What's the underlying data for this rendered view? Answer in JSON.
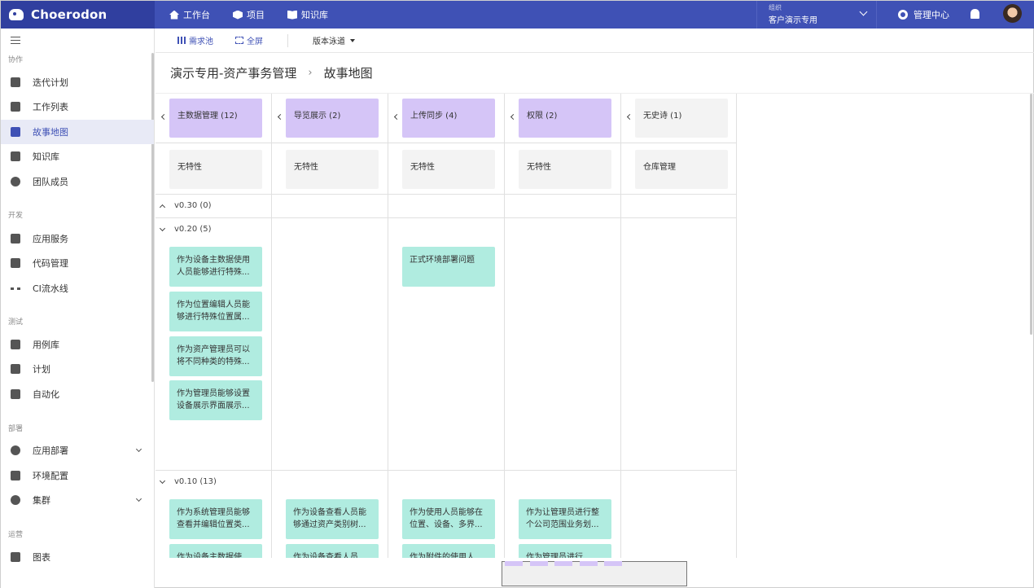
{
  "app": {
    "name": "Choerodon"
  },
  "topnav": [
    {
      "label": "工作台",
      "icon": "home-icon"
    },
    {
      "label": "项目",
      "icon": "cube-icon"
    },
    {
      "label": "知识库",
      "icon": "book-icon"
    }
  ],
  "org": {
    "label": "组织",
    "name": "客户演示专用"
  },
  "mgmt": {
    "label": "管理中心"
  },
  "sidebar": {
    "groups": [
      {
        "title": "协作",
        "items": [
          {
            "label": "迭代计划"
          },
          {
            "label": "工作列表"
          },
          {
            "label": "故事地图",
            "active": true
          },
          {
            "label": "知识库"
          },
          {
            "label": "团队成员"
          }
        ]
      },
      {
        "title": "开发",
        "items": [
          {
            "label": "应用服务"
          },
          {
            "label": "代码管理"
          },
          {
            "label": "CI流水线"
          }
        ]
      },
      {
        "title": "测试",
        "items": [
          {
            "label": "用例库"
          },
          {
            "label": "计划"
          },
          {
            "label": "自动化"
          }
        ]
      },
      {
        "title": "部署",
        "items": [
          {
            "label": "应用部署"
          },
          {
            "label": "环境配置"
          },
          {
            "label": "集群"
          }
        ]
      },
      {
        "title": "运营",
        "items": [
          {
            "label": "图表"
          }
        ]
      }
    ]
  },
  "toolbar": {
    "demand_pool": "需求池",
    "fullscreen": "全屏",
    "swimlane": "版本泳道"
  },
  "breadcrumb": {
    "project": "演示专用-资产事务管理",
    "page": "故事地图"
  },
  "epics": [
    {
      "label": "主数据管理 (12)",
      "color": "#d5c5f7"
    },
    {
      "label": "导览展示 (2)",
      "color": "#d5c5f7"
    },
    {
      "label": "上传同步 (4)",
      "color": "#d5c5f7"
    },
    {
      "label": "权限 (2)",
      "color": "#d5c5f7"
    },
    {
      "label": "无史诗 (1)",
      "color": "#f3f3f3"
    }
  ],
  "features": [
    "无特性",
    "无特性",
    "无特性",
    "无特性",
    "仓库管理"
  ],
  "releases": [
    {
      "label": "v0.30 (0)"
    },
    {
      "label": "v0.20 (5)"
    },
    {
      "label": "v0.10 (13)"
    }
  ],
  "stories": {
    "v020": {
      "col0": [
        "作为设备主数据使用人员能够进行特殊...",
        "作为位置编辑人员能够进行特殊位置属...",
        "作为资产管理员可以将不同种类的特殊...",
        "作为管理员能够设置设备展示界面展示..."
      ],
      "col2": [
        "正式环境部署问题"
      ]
    },
    "v010": {
      "col0": [
        "作为系统管理员能够查看并编辑位置类...",
        "作为设备主数据使用..."
      ],
      "col1": [
        "作为设备查看人员能够通过资产类别树...",
        "作为设备查看人员能..."
      ],
      "col2": [
        "作为使用人员能够在位置、设备、多界...",
        "作为附件的使用人员..."
      ],
      "col3": [
        "作为让管理员进行整个公司范围业务划...",
        "作为管理员进行...."
      ]
    }
  }
}
